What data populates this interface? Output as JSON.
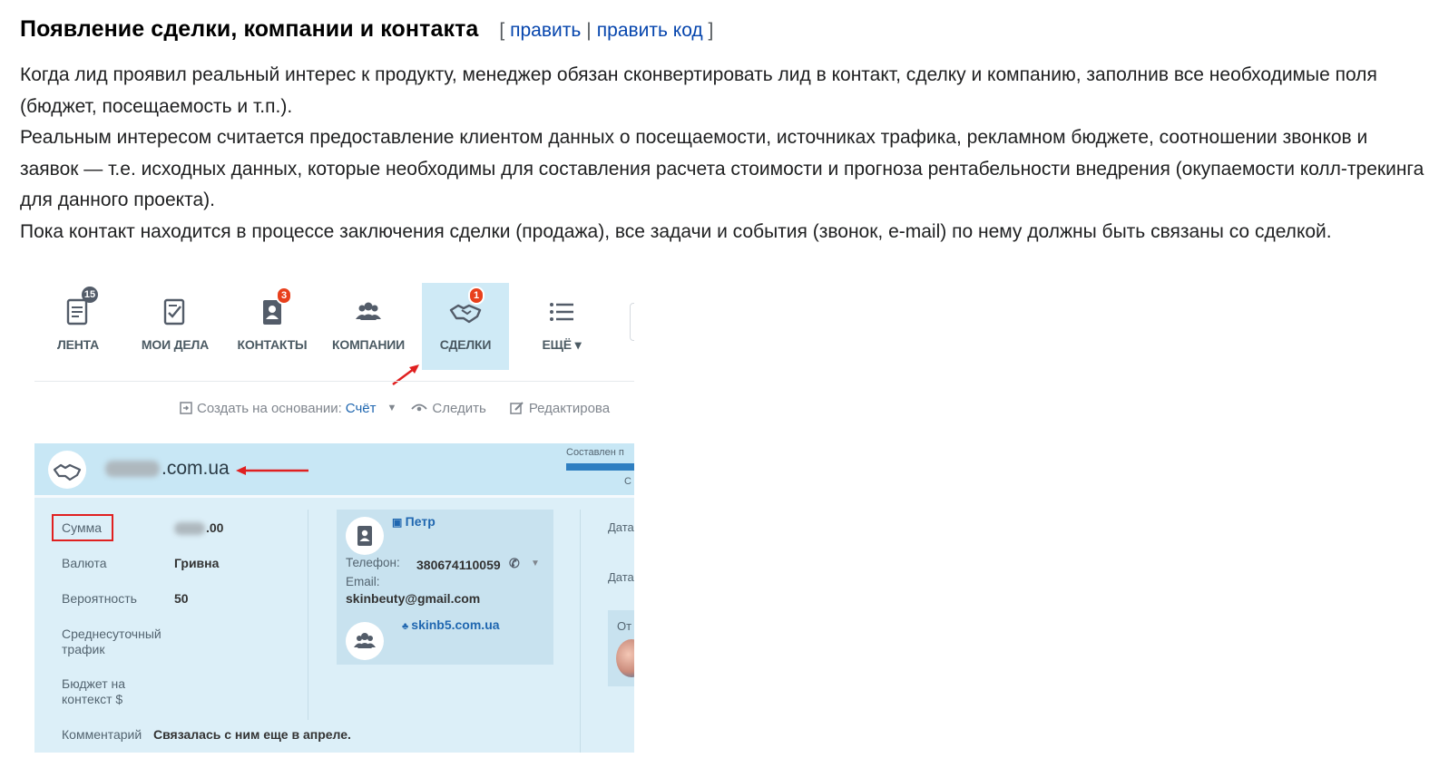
{
  "section": {
    "title": "Появление сделки, компании и контакта",
    "edit": {
      "open": "[",
      "link1": "править",
      "separator": "|",
      "link2": "править код",
      "close": "]"
    }
  },
  "paragraphs": [
    "Когда лид проявил реальный интерес к продукту, менеджер обязан сконвертировать лид в контакт, сделку и компанию, заполнив все необходимые поля (бюджет, посещаемость и т.п.).",
    "Реальным интересом считается предоставление клиентом данных о посещаемости, источниках трафика, рекламном бюджете, соотношении звонков и заявок — т.е. исходных данных, которые необходимы для составления расчета стоимости и прогноза рентабельности внедрения (окупаемости колл-трекинга для данного проекта).",
    "Пока контакт находится в процессе заключения сделки (продажа), все задачи и события (звонок, e-mail) по нему должны быть связаны со сделкой."
  ],
  "screenshot": {
    "tabs": [
      {
        "label": "ЛЕНТА",
        "icon": "feed-icon",
        "badge": "15"
      },
      {
        "label": "МОИ ДЕЛА",
        "icon": "tasks-icon",
        "badge": ""
      },
      {
        "label": "КОНТАКТЫ",
        "icon": "contacts-icon",
        "badge": "3"
      },
      {
        "label": "КОМПАНИИ",
        "icon": "companies-icon",
        "badge": ""
      },
      {
        "label": "СДЕЛКИ",
        "icon": "handshake-icon",
        "badge": "1"
      },
      {
        "label": "ЕЩЁ ▾",
        "icon": "list-icon",
        "badge": ""
      }
    ],
    "toolbar": {
      "create_label": "Создать на основании:",
      "create_value": "Счёт",
      "follow": "Следить",
      "edit": "Редактирова"
    },
    "deal": {
      "title_suffix": ".com.ua",
      "progress_label": "Составлен п",
      "progress_sub": "С",
      "fields": [
        {
          "label": "Сумма",
          "value": ".00"
        },
        {
          "label": "Валюта",
          "value": "Гривна"
        },
        {
          "label": "Вероятность",
          "value": "50"
        },
        {
          "label": "Среднесуточный трафик",
          "value": ""
        },
        {
          "label": "Бюджет на контекст $",
          "value": ""
        },
        {
          "label": "Комментарий",
          "value": "Связалась с ним еще в апреле."
        }
      ],
      "contact": {
        "name": "Петр",
        "phone_label": "Телефон:",
        "phone": "380674110059",
        "email_label": "Email:",
        "email": "skinbeuty@gmail.com",
        "company": "skinb5.com.ua"
      },
      "right": {
        "date1": "Дата нача",
        "date2": "Дата заве",
        "other": "От"
      }
    },
    "colors": {
      "accent": "#2067b0",
      "active_tab": "#cfeaf6",
      "deal_bg": "#dceff8",
      "annotation": "#e02020"
    }
  }
}
